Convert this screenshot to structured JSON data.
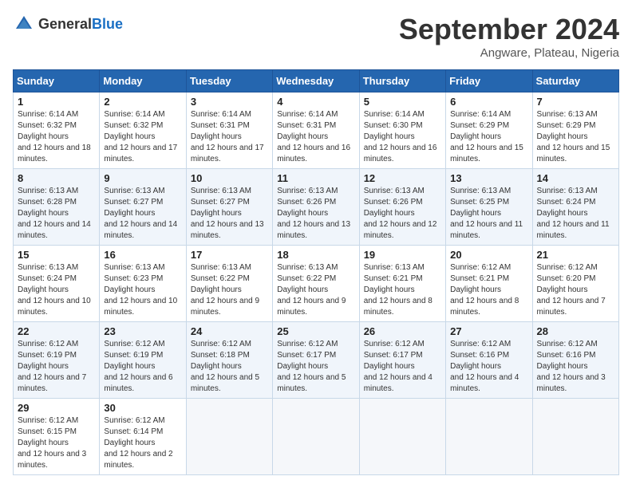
{
  "header": {
    "logo_general": "General",
    "logo_blue": "Blue",
    "month_title": "September 2024",
    "location": "Angware, Plateau, Nigeria"
  },
  "days_of_week": [
    "Sunday",
    "Monday",
    "Tuesday",
    "Wednesday",
    "Thursday",
    "Friday",
    "Saturday"
  ],
  "weeks": [
    [
      {
        "day": "1",
        "sunrise": "6:14 AM",
        "sunset": "6:32 PM",
        "daylight": "12 hours and 18 minutes."
      },
      {
        "day": "2",
        "sunrise": "6:14 AM",
        "sunset": "6:32 PM",
        "daylight": "12 hours and 17 minutes."
      },
      {
        "day": "3",
        "sunrise": "6:14 AM",
        "sunset": "6:31 PM",
        "daylight": "12 hours and 17 minutes."
      },
      {
        "day": "4",
        "sunrise": "6:14 AM",
        "sunset": "6:31 PM",
        "daylight": "12 hours and 16 minutes."
      },
      {
        "day": "5",
        "sunrise": "6:14 AM",
        "sunset": "6:30 PM",
        "daylight": "12 hours and 16 minutes."
      },
      {
        "day": "6",
        "sunrise": "6:14 AM",
        "sunset": "6:29 PM",
        "daylight": "12 hours and 15 minutes."
      },
      {
        "day": "7",
        "sunrise": "6:13 AM",
        "sunset": "6:29 PM",
        "daylight": "12 hours and 15 minutes."
      }
    ],
    [
      {
        "day": "8",
        "sunrise": "6:13 AM",
        "sunset": "6:28 PM",
        "daylight": "12 hours and 14 minutes."
      },
      {
        "day": "9",
        "sunrise": "6:13 AM",
        "sunset": "6:27 PM",
        "daylight": "12 hours and 14 minutes."
      },
      {
        "day": "10",
        "sunrise": "6:13 AM",
        "sunset": "6:27 PM",
        "daylight": "12 hours and 13 minutes."
      },
      {
        "day": "11",
        "sunrise": "6:13 AM",
        "sunset": "6:26 PM",
        "daylight": "12 hours and 13 minutes."
      },
      {
        "day": "12",
        "sunrise": "6:13 AM",
        "sunset": "6:26 PM",
        "daylight": "12 hours and 12 minutes."
      },
      {
        "day": "13",
        "sunrise": "6:13 AM",
        "sunset": "6:25 PM",
        "daylight": "12 hours and 11 minutes."
      },
      {
        "day": "14",
        "sunrise": "6:13 AM",
        "sunset": "6:24 PM",
        "daylight": "12 hours and 11 minutes."
      }
    ],
    [
      {
        "day": "15",
        "sunrise": "6:13 AM",
        "sunset": "6:24 PM",
        "daylight": "12 hours and 10 minutes."
      },
      {
        "day": "16",
        "sunrise": "6:13 AM",
        "sunset": "6:23 PM",
        "daylight": "12 hours and 10 minutes."
      },
      {
        "day": "17",
        "sunrise": "6:13 AM",
        "sunset": "6:22 PM",
        "daylight": "12 hours and 9 minutes."
      },
      {
        "day": "18",
        "sunrise": "6:13 AM",
        "sunset": "6:22 PM",
        "daylight": "12 hours and 9 minutes."
      },
      {
        "day": "19",
        "sunrise": "6:13 AM",
        "sunset": "6:21 PM",
        "daylight": "12 hours and 8 minutes."
      },
      {
        "day": "20",
        "sunrise": "6:12 AM",
        "sunset": "6:21 PM",
        "daylight": "12 hours and 8 minutes."
      },
      {
        "day": "21",
        "sunrise": "6:12 AM",
        "sunset": "6:20 PM",
        "daylight": "12 hours and 7 minutes."
      }
    ],
    [
      {
        "day": "22",
        "sunrise": "6:12 AM",
        "sunset": "6:19 PM",
        "daylight": "12 hours and 7 minutes."
      },
      {
        "day": "23",
        "sunrise": "6:12 AM",
        "sunset": "6:19 PM",
        "daylight": "12 hours and 6 minutes."
      },
      {
        "day": "24",
        "sunrise": "6:12 AM",
        "sunset": "6:18 PM",
        "daylight": "12 hours and 5 minutes."
      },
      {
        "day": "25",
        "sunrise": "6:12 AM",
        "sunset": "6:17 PM",
        "daylight": "12 hours and 5 minutes."
      },
      {
        "day": "26",
        "sunrise": "6:12 AM",
        "sunset": "6:17 PM",
        "daylight": "12 hours and 4 minutes."
      },
      {
        "day": "27",
        "sunrise": "6:12 AM",
        "sunset": "6:16 PM",
        "daylight": "12 hours and 4 minutes."
      },
      {
        "day": "28",
        "sunrise": "6:12 AM",
        "sunset": "6:16 PM",
        "daylight": "12 hours and 3 minutes."
      }
    ],
    [
      {
        "day": "29",
        "sunrise": "6:12 AM",
        "sunset": "6:15 PM",
        "daylight": "12 hours and 3 minutes."
      },
      {
        "day": "30",
        "sunrise": "6:12 AM",
        "sunset": "6:14 PM",
        "daylight": "12 hours and 2 minutes."
      },
      null,
      null,
      null,
      null,
      null
    ]
  ]
}
